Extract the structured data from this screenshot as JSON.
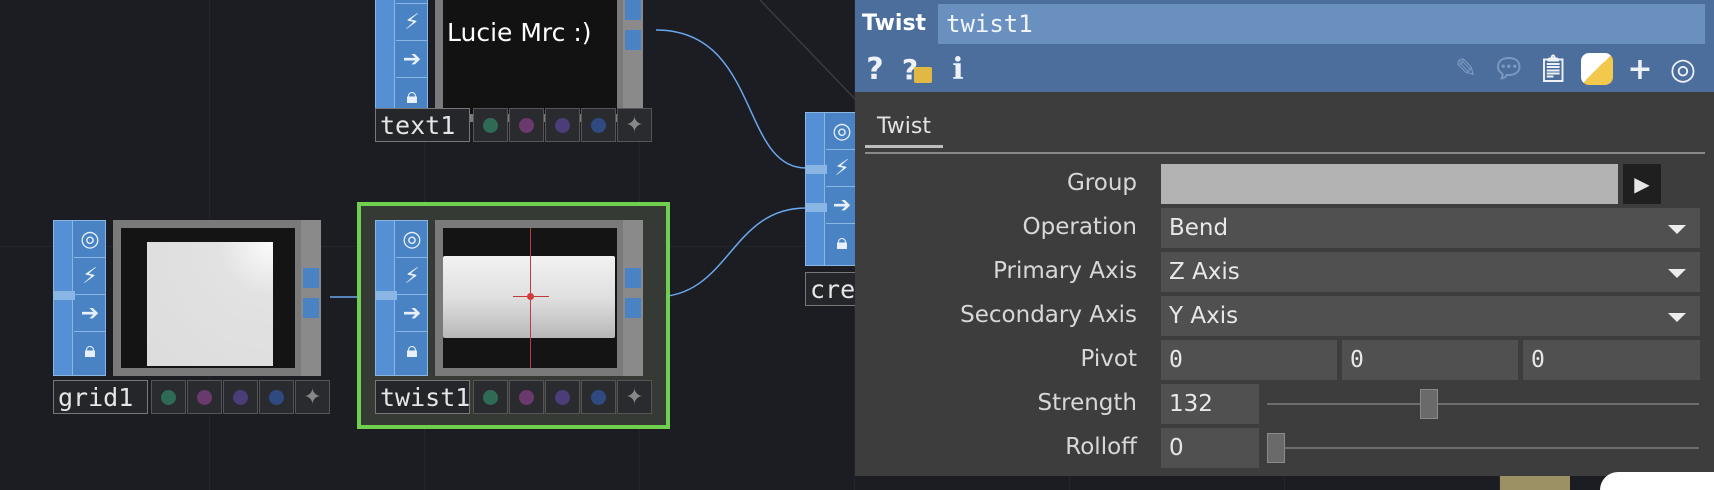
{
  "nodes": {
    "text1": {
      "label": "text1",
      "preview_text": "Lucie Mrc :)"
    },
    "grid1": {
      "label": "grid1"
    },
    "twist1": {
      "label": "twist1"
    },
    "create": {
      "label": "cre"
    }
  },
  "panel": {
    "type_label": "Twist",
    "node_name": "twist1",
    "toolbar_icons": [
      "help-icon",
      "operator-help-icon",
      "info-icon",
      "edit-icon",
      "comment-icon",
      "clipboard-icon",
      "python-icon",
      "add-icon",
      "target-icon"
    ],
    "tab": "Twist",
    "params": {
      "group": {
        "label": "Group",
        "value": ""
      },
      "operation": {
        "label": "Operation",
        "value": "Bend"
      },
      "primary_axis": {
        "label": "Primary Axis",
        "value": "Z Axis"
      },
      "secondary_axis": {
        "label": "Secondary Axis",
        "value": "Y Axis"
      },
      "pivot": {
        "label": "Pivot",
        "x": "0",
        "y": "0",
        "z": "0"
      },
      "strength": {
        "label": "Strength",
        "value": "132"
      },
      "rolloff": {
        "label": "Rolloff",
        "value": "0"
      }
    }
  },
  "colors": {
    "accent": "#4c6e9c",
    "selected": "#6fd050",
    "node_blue": "#4a83c4"
  }
}
